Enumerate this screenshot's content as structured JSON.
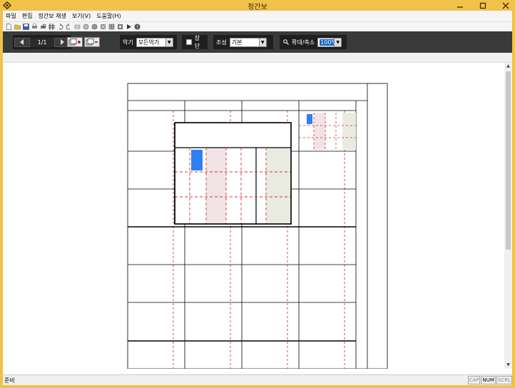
{
  "window": {
    "title": "정간보"
  },
  "menu": {
    "items": [
      {
        "label": "파일"
      },
      {
        "label": "편집"
      },
      {
        "label": "정간보 재생"
      },
      {
        "label": "보기(V)"
      },
      {
        "label": "도움말(H)"
      }
    ]
  },
  "toolbar1": {
    "icons": [
      "new-icon",
      "open-icon",
      "save-icon",
      "print-icon",
      "print-preview-icon",
      "grid-icon",
      "undo-icon",
      "redo-icon",
      "cut-icon",
      "copy-icon",
      "paste-icon",
      "delete-icon",
      "find-icon",
      "settings-icon",
      "play-icon",
      "help-icon"
    ]
  },
  "toolbar2": {
    "page_indicator": "1/1",
    "instrument_label": "악기",
    "instrument_value": "모든악기",
    "jangdan_label": "장단",
    "jo_label": "조성",
    "jo_value": "기본",
    "zoom_label": "확대/축소",
    "zoom_value": "100%"
  },
  "status": {
    "text": "준비",
    "indicators": [
      {
        "label": "CAP",
        "active": false
      },
      {
        "label": "NUM",
        "active": true
      },
      {
        "label": "SCRL",
        "active": false
      }
    ]
  },
  "colors": {
    "title_bar": "#f0c24a",
    "toolbar_dark": "#3a3a3a",
    "selection_blue": "#2f7ff5",
    "pink_column": "#f1e3e6",
    "green_column": "#e9ebe0",
    "red_dashed": "#d33333"
  }
}
